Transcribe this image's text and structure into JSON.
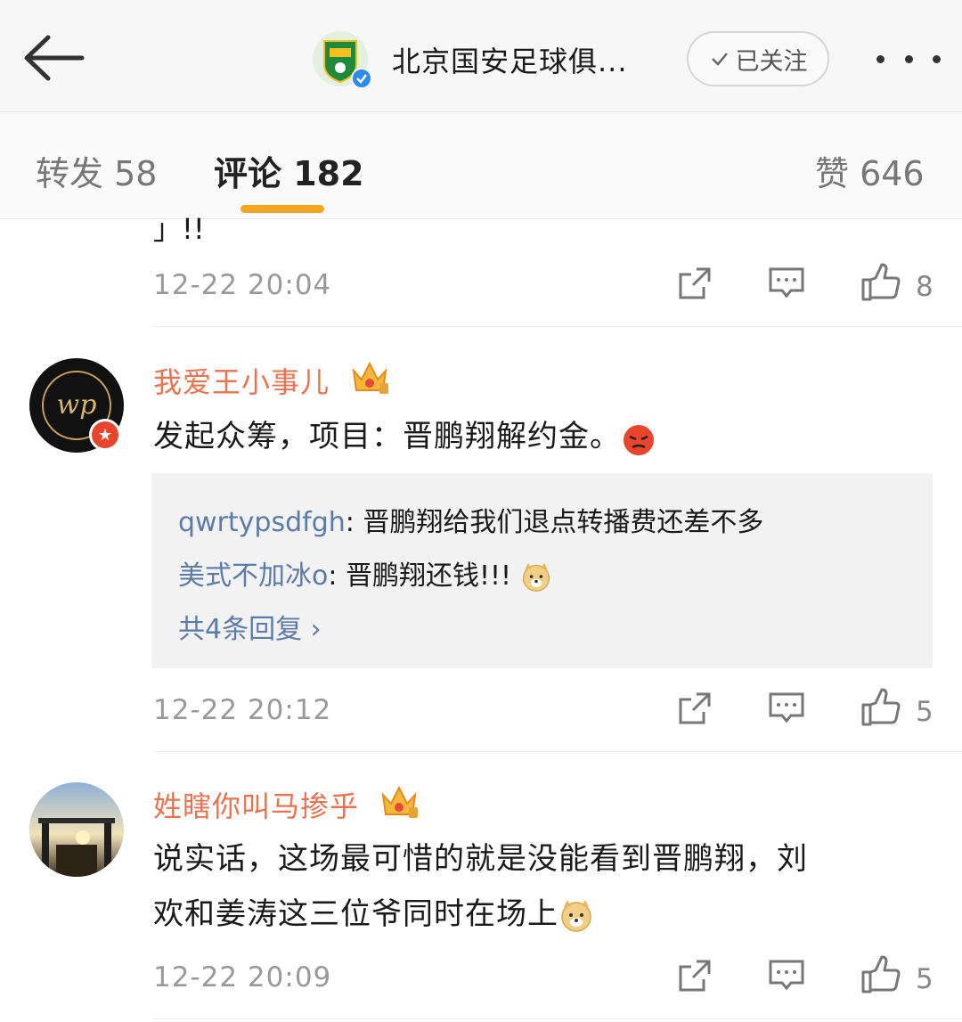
{
  "header": {
    "back_icon": "back-arrow-icon",
    "account_title": "北京国安足球俱...",
    "follow_label": "已关注",
    "more_icon": "more-dots-icon"
  },
  "tabs": {
    "repost": "转发 58",
    "comment": "评论 182",
    "like": "赞 646"
  },
  "comments": [
    {
      "text_tail": "」!!",
      "time": "12-22 20:04",
      "likes": "8"
    },
    {
      "username": "我爱王小事儿",
      "text": "发起众筹，项目：晋鹏翔解约金。",
      "emoji": "angry-face-icon",
      "replies": [
        {
          "user": "qwrtypsdfgh",
          "text": ": 晋鹏翔给我们退点转播费还差不多"
        },
        {
          "user": "美式不加冰o",
          "text": ": 晋鹏翔还钱!!! "
        }
      ],
      "reply_more": "共4条回复 ›",
      "time": "12-22 20:12",
      "likes": "5"
    },
    {
      "username": "姓瞎你叫马掺乎",
      "text_line1": "说实话，这场最可惜的就是没能看到晋鹏翔，刘",
      "text_line2": "欢和姜涛这三位爷同时在场上",
      "time": "12-22 20:09",
      "likes": "5"
    }
  ],
  "colors": {
    "username": "#eb7350",
    "reply_user": "#5b7ba8",
    "tab_underline": "#f5a623",
    "meta": "#999999"
  }
}
